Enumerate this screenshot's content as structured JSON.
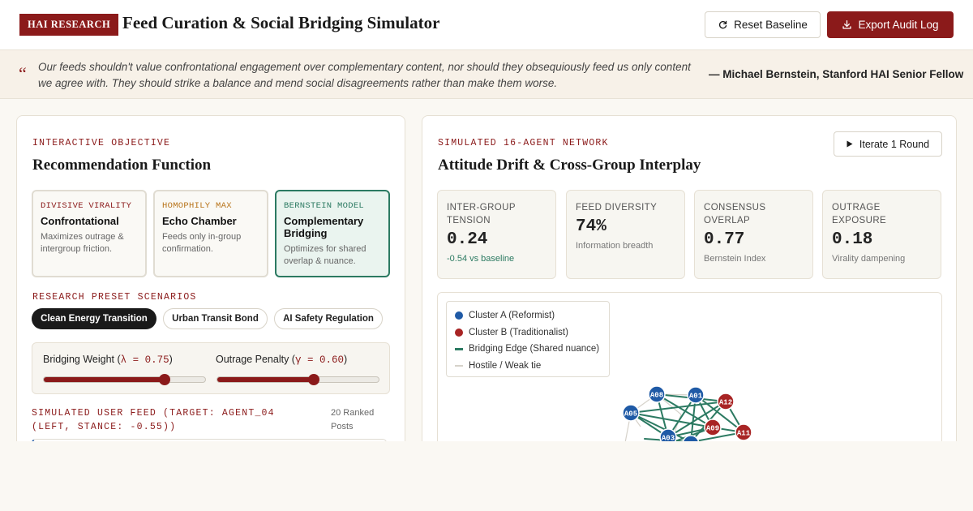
{
  "header": {
    "brand": "HAI RESEARCH",
    "title": "Feed Curation & Social Bridging Simulator",
    "reset_label": "Reset Baseline",
    "export_label": "Export Audit Log",
    "reset_icon": "refresh-icon",
    "export_icon": "download-icon"
  },
  "quote": {
    "text": "Our feeds shouldn't value confrontational engagement over complementary content, nor should they obsequiously feed us only content we agree with. They should strike a balance and mend social disagreements rather than make them worse.",
    "attribution": "— Michael Bernstein, Stanford HAI Senior Fellow"
  },
  "left_panel": {
    "eyebrow": "INTERACTIVE OBJECTIVE",
    "heading": "Recommendation Function",
    "objectives": [
      {
        "tag": "DIVISIVE VIRALITY",
        "name": "Confrontational",
        "desc": "Maximizes outrage & intergroup friction.",
        "tag_color": "#8b1a1a",
        "active": false
      },
      {
        "tag": "HOMOPHILY MAX",
        "name": "Echo Chamber",
        "desc": "Feeds only in-group confirmation.",
        "tag_color": "#b8741a",
        "active": false
      },
      {
        "tag": "BERNSTEIN MODEL",
        "name": "Complementary Bridging",
        "desc": "Optimizes for shared overlap & nuance.",
        "tag_color": "#2c7a62",
        "active": true
      }
    ],
    "presets_eyebrow": "RESEARCH PRESET SCENARIOS",
    "presets": [
      "Clean Energy Transition",
      "Urban Transit Bond",
      "AI Safety Regulation"
    ],
    "active_preset": "Clean Energy Transition",
    "sliders": [
      {
        "label": "Bridging Weight (",
        "param": "λ = 0.75",
        "close": ")",
        "value": 0.75
      },
      {
        "label": "Outrage Penalty (",
        "param": "γ = 0.60",
        "close": ")",
        "value": 0.6
      }
    ],
    "feed_eyebrow": "SIMULATED USER FEED (TARGET: AGENT_04 (LEFT, STANCE: -0.55))",
    "feed_count": "20 Ranked Posts"
  },
  "right_panel": {
    "eyebrow": "SIMULATED 16-AGENT NETWORK",
    "heading": "Attitude Drift & Cross-Group Interplay",
    "iterate_label": "Iterate 1 Round",
    "iterate_icon": "play-icon",
    "metrics": [
      {
        "label": "INTER-GROUP TENSION",
        "value": "0.24",
        "sub": "-0.54 vs baseline"
      },
      {
        "label": "FEED DIVERSITY",
        "value": "74%",
        "sub": "Information breadth"
      },
      {
        "label": "CONSENSUS OVERLAP",
        "value": "0.77",
        "sub": "Bernstein Index"
      },
      {
        "label": "OUTRAGE EXPOSURE",
        "value": "0.18",
        "sub": "Virality dampening"
      }
    ],
    "legend": [
      {
        "label": "Cluster A (Reformist)",
        "color": "#1f5aa6",
        "kind": "dot"
      },
      {
        "label": "Cluster B (Traditionalist)",
        "color": "#a82424",
        "kind": "dot"
      },
      {
        "label": "Bridging Edge (Shared nuance)",
        "color": "#2c7a62",
        "kind": "line"
      },
      {
        "label": "Hostile / Weak tie",
        "color": "#d6d2ca",
        "kind": "line"
      }
    ],
    "nodes": [
      {
        "id": "A05",
        "cluster": "A"
      },
      {
        "id": "A08",
        "cluster": "A"
      },
      {
        "id": "A01",
        "cluster": "A"
      },
      {
        "id": "A12",
        "cluster": "B"
      },
      {
        "id": "A09",
        "cluster": "B"
      },
      {
        "id": "A11",
        "cluster": "B"
      },
      {
        "id": "A03",
        "cluster": "A"
      }
    ]
  }
}
